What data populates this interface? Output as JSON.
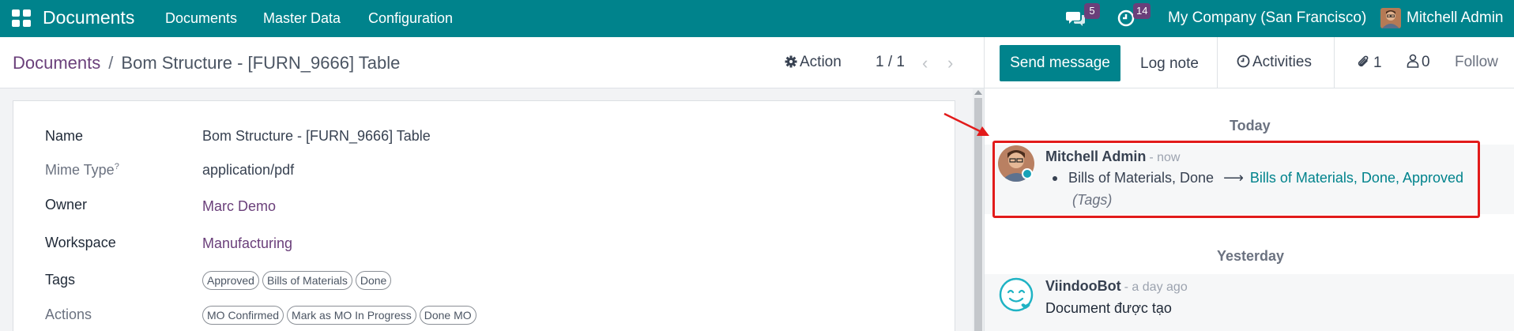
{
  "navbar": {
    "app_title": "Documents",
    "menu": [
      "Documents",
      "Master Data",
      "Configuration"
    ],
    "messages_count": "5",
    "activities_count": "14",
    "company": "My Company (San Francisco)",
    "user": "Mitchell Admin"
  },
  "breadcrumb": {
    "parent": "Documents",
    "separator": "/",
    "current": "Bom Structure - [FURN_9666] Table"
  },
  "control_panel": {
    "action_label": "Action",
    "pager": "1 / 1"
  },
  "form": {
    "fields": [
      {
        "label": "Name",
        "value": "Bom Structure - [FURN_9666] Table"
      },
      {
        "label": "Mime Type",
        "help": "?",
        "value": "application/pdf"
      },
      {
        "label": "Owner",
        "value": "Marc Demo"
      },
      {
        "label": "Workspace",
        "value": "Manufacturing"
      }
    ],
    "tags_label": "Tags",
    "tags": [
      "Approved",
      "Bills of Materials",
      "Done"
    ],
    "actions_label": "Actions",
    "actions": [
      "MO Confirmed",
      "Mark as MO In Progress",
      "Done MO"
    ]
  },
  "chatter": {
    "send_message": "Send message",
    "log_note": "Log note",
    "activities": "Activities",
    "attachments_count": "1",
    "followers_count": "0",
    "follow": "Follow",
    "groups": [
      {
        "date": "Today",
        "author": "Mitchell Admin",
        "time": "- now",
        "old_value": "Bills of Materials, Done",
        "new_value": "Bills of Materials, Done, Approved",
        "field": "(Tags)"
      },
      {
        "date": "Yesterday",
        "author": "ViindooBot",
        "time": "- a day ago",
        "body": "Document được tạo"
      }
    ]
  },
  "colors": {
    "brand": "#00838c",
    "link": "#6a3f7a",
    "highlight": "#e21b1b"
  }
}
